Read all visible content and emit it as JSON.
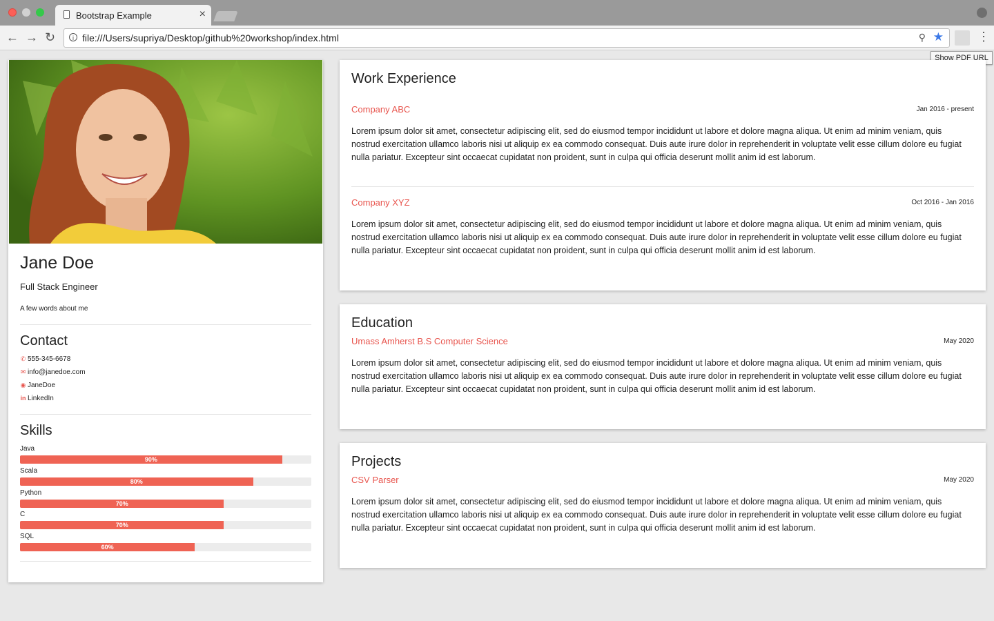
{
  "browser": {
    "tab_title": "Bootstrap Example",
    "tab_close": "×",
    "url": "file:///Users/supriya/Desktop/github%20workshop/index.html",
    "tooltip": "Show PDF URL"
  },
  "profile": {
    "name": "Jane Doe",
    "title": "Full Stack Engineer",
    "about": "A few words about me"
  },
  "contact": {
    "heading": "Contact",
    "items": [
      {
        "icon": "phone-icon",
        "text": "555-345-6678"
      },
      {
        "icon": "envelope-icon",
        "text": "info@janedoe.com"
      },
      {
        "icon": "github-icon",
        "text": "JaneDoe"
      },
      {
        "icon": "linkedin-icon",
        "text": "LinkedIn"
      }
    ]
  },
  "skills": {
    "heading": "Skills",
    "items": [
      {
        "name": "Java",
        "percent": 90,
        "label": "90%"
      },
      {
        "name": "Scala",
        "percent": 80,
        "label": "80%"
      },
      {
        "name": "Python",
        "percent": 70,
        "label": "70%"
      },
      {
        "name": "C",
        "percent": 70,
        "label": "70%"
      },
      {
        "name": "SQL",
        "percent": 60,
        "label": "60%"
      }
    ]
  },
  "work": {
    "heading": "Work Experience",
    "entries": [
      {
        "company": "Company ABC",
        "dates": "Jan 2016 - present",
        "text": "Lorem ipsum dolor sit amet, consectetur adipiscing elit, sed do eiusmod tempor incididunt ut labore et dolore magna aliqua. Ut enim ad minim veniam, quis nostrud exercitation ullamco laboris nisi ut aliquip ex ea commodo consequat. Duis aute irure dolor in reprehenderit in voluptate velit esse cillum dolore eu fugiat nulla pariatur. Excepteur sint occaecat cupidatat non proident, sunt in culpa qui officia deserunt mollit anim id est laborum."
      },
      {
        "company": "Company XYZ",
        "dates": "Oct 2016 - Jan 2016",
        "text": "Lorem ipsum dolor sit amet, consectetur adipiscing elit, sed do eiusmod tempor incididunt ut labore et dolore magna aliqua. Ut enim ad minim veniam, quis nostrud exercitation ullamco laboris nisi ut aliquip ex ea commodo consequat. Duis aute irure dolor in reprehenderit in voluptate velit esse cillum dolore eu fugiat nulla pariatur. Excepteur sint occaecat cupidatat non proident, sunt in culpa qui officia deserunt mollit anim id est laborum."
      }
    ]
  },
  "education": {
    "heading": "Education",
    "entry": {
      "title": "Umass Amherst B.S Computer Science",
      "date": "May 2020",
      "text": "Lorem ipsum dolor sit amet, consectetur adipiscing elit, sed do eiusmod tempor incididunt ut labore et dolore magna aliqua. Ut enim ad minim veniam, quis nostrud exercitation ullamco laboris nisi ut aliquip ex ea commodo consequat. Duis aute irure dolor in reprehenderit in voluptate velit esse cillum dolore eu fugiat nulla pariatur. Excepteur sint occaecat cupidatat non proident, sunt in culpa qui officia deserunt mollit anim id est laborum."
    }
  },
  "projects": {
    "heading": "Projects",
    "entry": {
      "title": "CSV Parser",
      "date": "May 2020",
      "text": "Lorem ipsum dolor sit amet, consectetur adipiscing elit, sed do eiusmod tempor incididunt ut labore et dolore magna aliqua. Ut enim ad minim veniam, quis nostrud exercitation ullamco laboris nisi ut aliquip ex ea commodo consequat. Duis aute irure dolor in reprehenderit in voluptate velit esse cillum dolore eu fugiat nulla pariatur. Excepteur sint occaecat cupidatat non proident, sunt in culpa qui officia deserunt mollit anim id est laborum."
    }
  },
  "colors": {
    "accent": "#e8554e",
    "bar": "#ef6354",
    "page_bg": "#e8e8e8"
  }
}
